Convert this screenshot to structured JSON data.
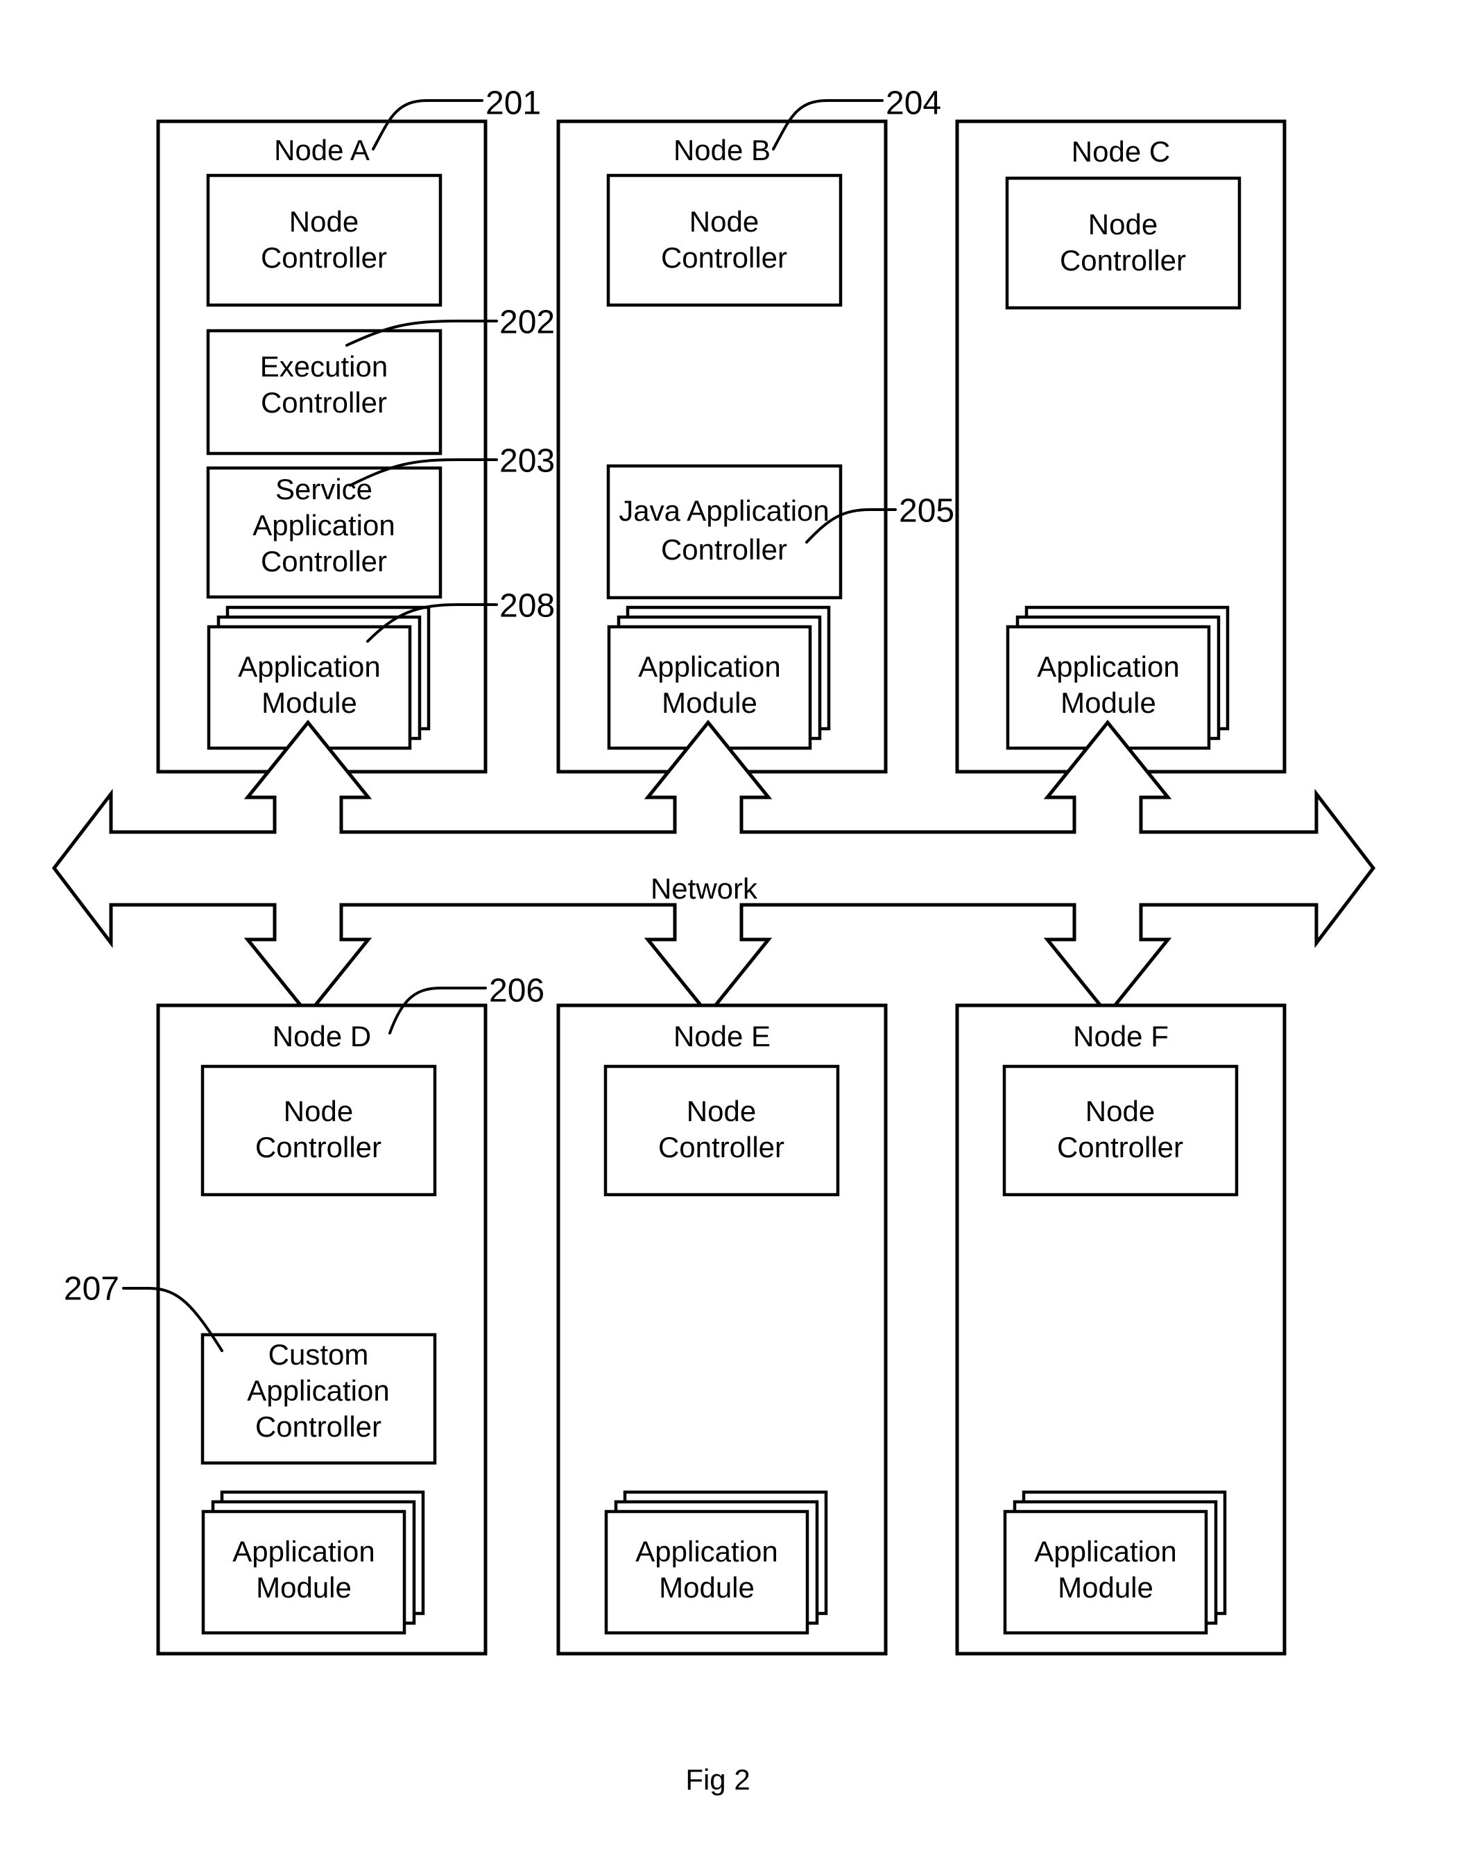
{
  "figure": {
    "caption": "Fig 2",
    "network_label": "Network"
  },
  "nodes": [
    {
      "id": "node-a",
      "title": "Node A",
      "ref": "201",
      "boxes": [
        {
          "id": "node-controller",
          "label": "Node Controller",
          "lines": [
            "Node",
            "Controller"
          ],
          "ref": null
        },
        {
          "id": "execution-controller",
          "label": "Execution Controller",
          "lines": [
            "Execution",
            "Controller"
          ],
          "ref": "202"
        },
        {
          "id": "service-application-controller",
          "label": "Service Application Controller",
          "lines": [
            "Service",
            "Application",
            "Controller"
          ],
          "ref": "203"
        },
        {
          "id": "application-module",
          "label": "Application Module",
          "lines": [
            "Application",
            "Module"
          ],
          "ref": "208",
          "stacked": true
        }
      ]
    },
    {
      "id": "node-b",
      "title": "Node B",
      "ref": "204",
      "boxes": [
        {
          "id": "node-controller",
          "label": "Node Controller",
          "lines": [
            "Node",
            "Controller"
          ],
          "ref": null
        },
        {
          "id": "java-application-controller",
          "label": "Java Application Controller",
          "lines": [
            "Java Application",
            "Controller"
          ],
          "ref": "205"
        },
        {
          "id": "application-module",
          "label": "Application Module",
          "lines": [
            "Application",
            "Module"
          ],
          "ref": null,
          "stacked": true
        }
      ]
    },
    {
      "id": "node-c",
      "title": "Node C",
      "ref": null,
      "boxes": [
        {
          "id": "node-controller",
          "label": "Node Controller",
          "lines": [
            "Node",
            "Controller"
          ],
          "ref": null
        },
        {
          "id": "application-module",
          "label": "Application Module",
          "lines": [
            "Application",
            "Module"
          ],
          "ref": null,
          "stacked": true
        }
      ]
    },
    {
      "id": "node-d",
      "title": "Node D",
      "ref": "206",
      "boxes": [
        {
          "id": "node-controller",
          "label": "Node Controller",
          "lines": [
            "Node",
            "Controller"
          ],
          "ref": null
        },
        {
          "id": "custom-application-controller",
          "label": "Custom Application Controller",
          "lines": [
            "Custom",
            "Application",
            "Controller"
          ],
          "ref": "207"
        },
        {
          "id": "application-module",
          "label": "Application Module",
          "lines": [
            "Application",
            "Module"
          ],
          "ref": null,
          "stacked": true
        }
      ]
    },
    {
      "id": "node-e",
      "title": "Node E",
      "ref": null,
      "boxes": [
        {
          "id": "node-controller",
          "label": "Node Controller",
          "lines": [
            "Node",
            "Controller"
          ],
          "ref": null
        },
        {
          "id": "application-module",
          "label": "Application Module",
          "lines": [
            "Application",
            "Module"
          ],
          "ref": null,
          "stacked": true
        }
      ]
    },
    {
      "id": "node-f",
      "title": "Node F",
      "ref": null,
      "boxes": [
        {
          "id": "node-controller",
          "label": "Node Controller",
          "lines": [
            "Node",
            "Controller"
          ],
          "ref": null
        },
        {
          "id": "application-module",
          "label": "Application Module",
          "lines": [
            "Application",
            "Module"
          ],
          "ref": null,
          "stacked": true
        }
      ]
    }
  ],
  "labels": {
    "node_a_title": "Node A",
    "node_b_title": "Node B",
    "node_c_title": "Node C",
    "node_d_title": "Node D",
    "node_e_title": "Node E",
    "node_f_title": "Node F",
    "node_controller_l1": "Node",
    "node_controller_l2": "Controller",
    "execution_controller_l1": "Execution",
    "execution_controller_l2": "Controller",
    "service_app_l1": "Service",
    "service_app_l2": "Application",
    "service_app_l3": "Controller",
    "custom_app_l1": "Custom",
    "custom_app_l2": "Application",
    "custom_app_l3": "Controller",
    "java_app_l1": "Java Application",
    "java_app_l2": "Controller",
    "app_module_l1": "Application",
    "app_module_l2": "Module"
  },
  "refs": {
    "r201": "201",
    "r202": "202",
    "r203": "203",
    "r204": "204",
    "r205": "205",
    "r206": "206",
    "r207": "207",
    "r208": "208"
  },
  "colors": {
    "stroke": "#000000",
    "background": "#ffffff"
  }
}
